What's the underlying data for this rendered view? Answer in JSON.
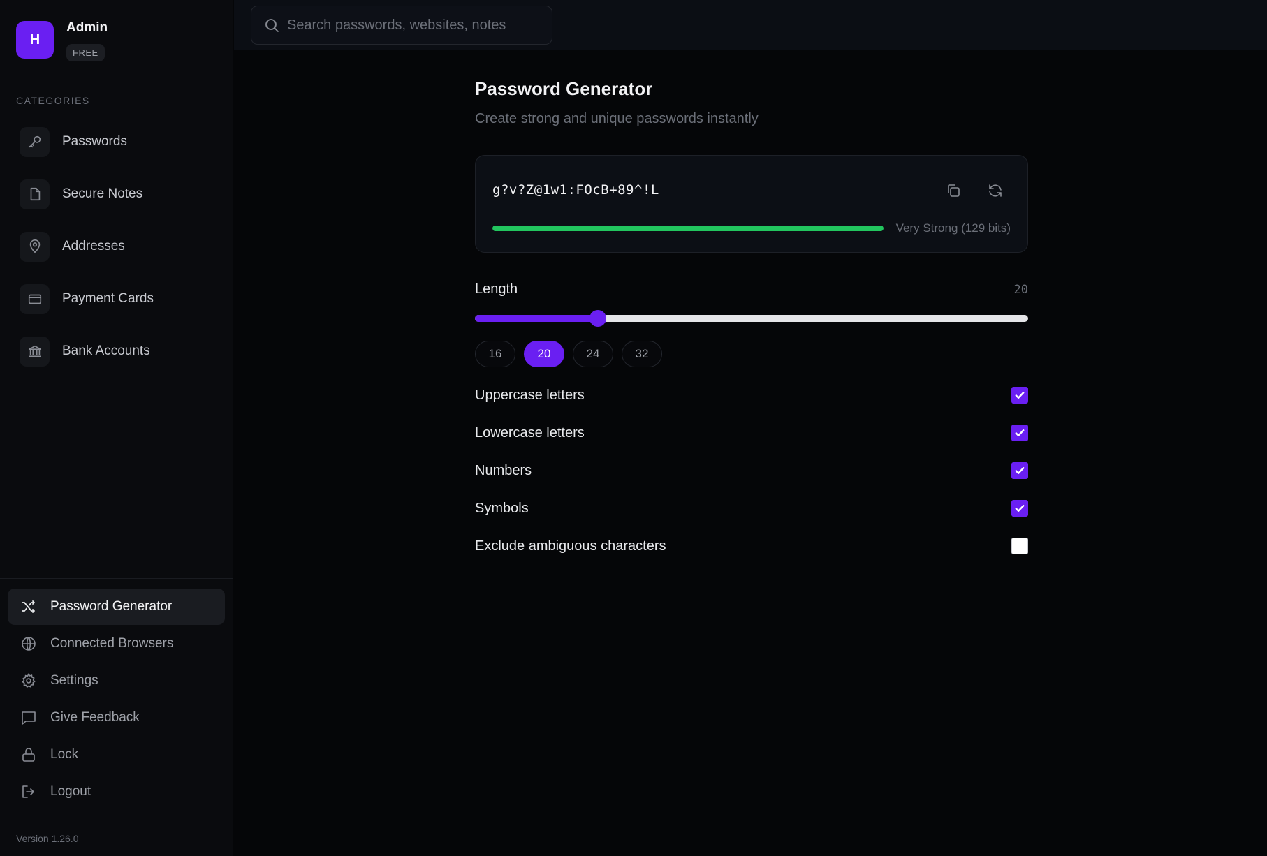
{
  "profile": {
    "initial": "H",
    "name": "Admin",
    "plan": "FREE"
  },
  "sidebar": {
    "categories_heading": "CATEGORIES",
    "categories": [
      {
        "label": "Passwords",
        "icon": "key-icon"
      },
      {
        "label": "Secure Notes",
        "icon": "note-icon"
      },
      {
        "label": "Addresses",
        "icon": "map-pin-icon"
      },
      {
        "label": "Payment Cards",
        "icon": "credit-card-icon"
      },
      {
        "label": "Bank Accounts",
        "icon": "bank-icon"
      }
    ],
    "nav": [
      {
        "label": "Password Generator",
        "icon": "shuffle-icon",
        "active": true
      },
      {
        "label": "Connected Browsers",
        "icon": "globe-icon"
      },
      {
        "label": "Settings",
        "icon": "gear-icon"
      },
      {
        "label": "Give Feedback",
        "icon": "message-icon"
      },
      {
        "label": "Lock",
        "icon": "lock-icon"
      },
      {
        "label": "Logout",
        "icon": "logout-icon"
      }
    ],
    "version": "Version 1.26.0"
  },
  "search": {
    "placeholder": "Search passwords, websites, notes",
    "value": ""
  },
  "generator": {
    "title": "Password Generator",
    "subtitle": "Create strong and unique passwords instantly",
    "password": "g?v?Z@1w1:FOcB+89^!L",
    "strength_label": "Very Strong (129 bits)",
    "strength_fraction": 1.0,
    "strength_color": "#22c55e",
    "length_label": "Length",
    "length_value": "20",
    "slider_fraction": 0.2222,
    "presets": [
      "16",
      "20",
      "24",
      "32"
    ],
    "active_preset": "20",
    "options": [
      {
        "label": "Uppercase letters",
        "checked": true
      },
      {
        "label": "Lowercase letters",
        "checked": true
      },
      {
        "label": "Numbers",
        "checked": true
      },
      {
        "label": "Symbols",
        "checked": true
      },
      {
        "label": "Exclude ambiguous characters",
        "checked": false
      }
    ]
  },
  "colors": {
    "accent": "#6a1ff2",
    "background": "#050608",
    "sidebar": "#0a0b0e"
  }
}
